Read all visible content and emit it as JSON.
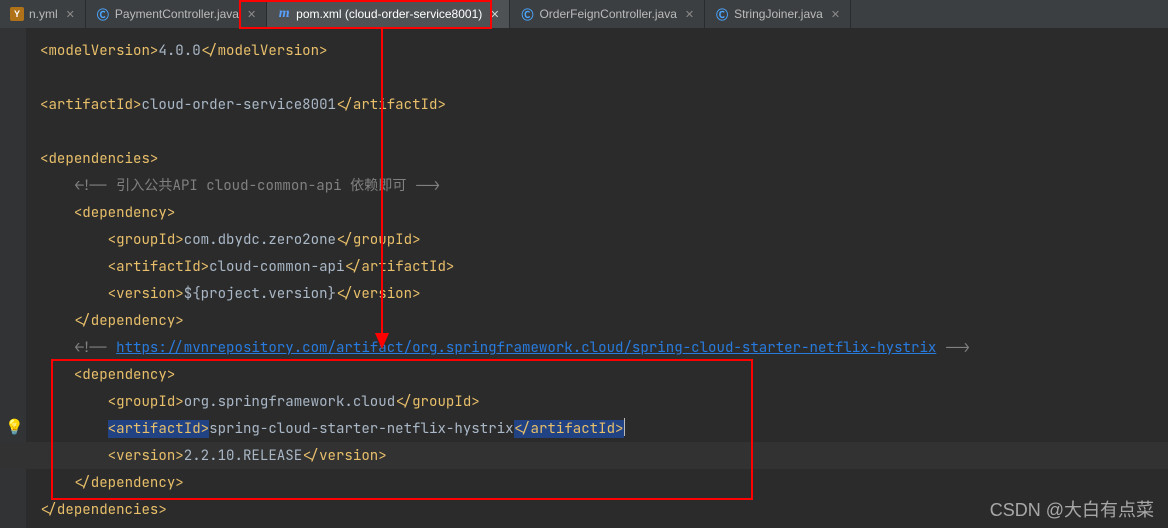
{
  "tabs": [
    {
      "icon": "y",
      "label": "n.yml",
      "active": false,
      "truncated": true
    },
    {
      "icon": "c",
      "label": "PaymentController.java",
      "active": false
    },
    {
      "icon": "m",
      "label": "pom.xml (cloud-order-service8001)",
      "active": true
    },
    {
      "icon": "c",
      "label": "OrderFeignController.java",
      "active": false
    },
    {
      "icon": "c",
      "label": "StringJoiner.java",
      "active": false
    }
  ],
  "code": {
    "l1": {
      "open": "<modelVersion>",
      "txt": "4.0.0",
      "close": "</modelVersion>"
    },
    "l3": {
      "open": "<artifactId>",
      "txt": "cloud-order-service8001",
      "close": "</artifactId>"
    },
    "l5": "<dependencies>",
    "l6": {
      "co": "<!-- ",
      "cm": "引入公共API cloud-common-api 依赖即可 ",
      "cc": "-->"
    },
    "l7": "<dependency>",
    "l8": {
      "open": "<groupId>",
      "txt": "com.dbydc.zero2one",
      "close": "</groupId>"
    },
    "l9": {
      "open": "<artifactId>",
      "txt": "cloud-common-api",
      "close": "</artifactId>"
    },
    "l10": {
      "open": "<version>",
      "txt": "${project.version}",
      "close": "</version>"
    },
    "l11": "</dependency>",
    "l12": {
      "co": "<!-- ",
      "url": "https://mvnrepository.com/artifact/org.springframework.cloud/spring-cloud-starter-netflix-hystrix",
      "cc": " -->"
    },
    "l13": "<dependency>",
    "l14": {
      "open": "<groupId>",
      "txt": "org.springframework.cloud",
      "close": "</groupId>"
    },
    "l15": {
      "open": "<artifactId>",
      "txt": "spring-cloud-starter-netflix-hystrix",
      "close": "</artifactId>"
    },
    "l16": {
      "open": "<version>",
      "txt": "2.2.10.RELEASE",
      "close": "</version>"
    },
    "l17": "</dependency>",
    "l18": "</dependencies>"
  },
  "watermark": "CSDN @大白有点菜"
}
